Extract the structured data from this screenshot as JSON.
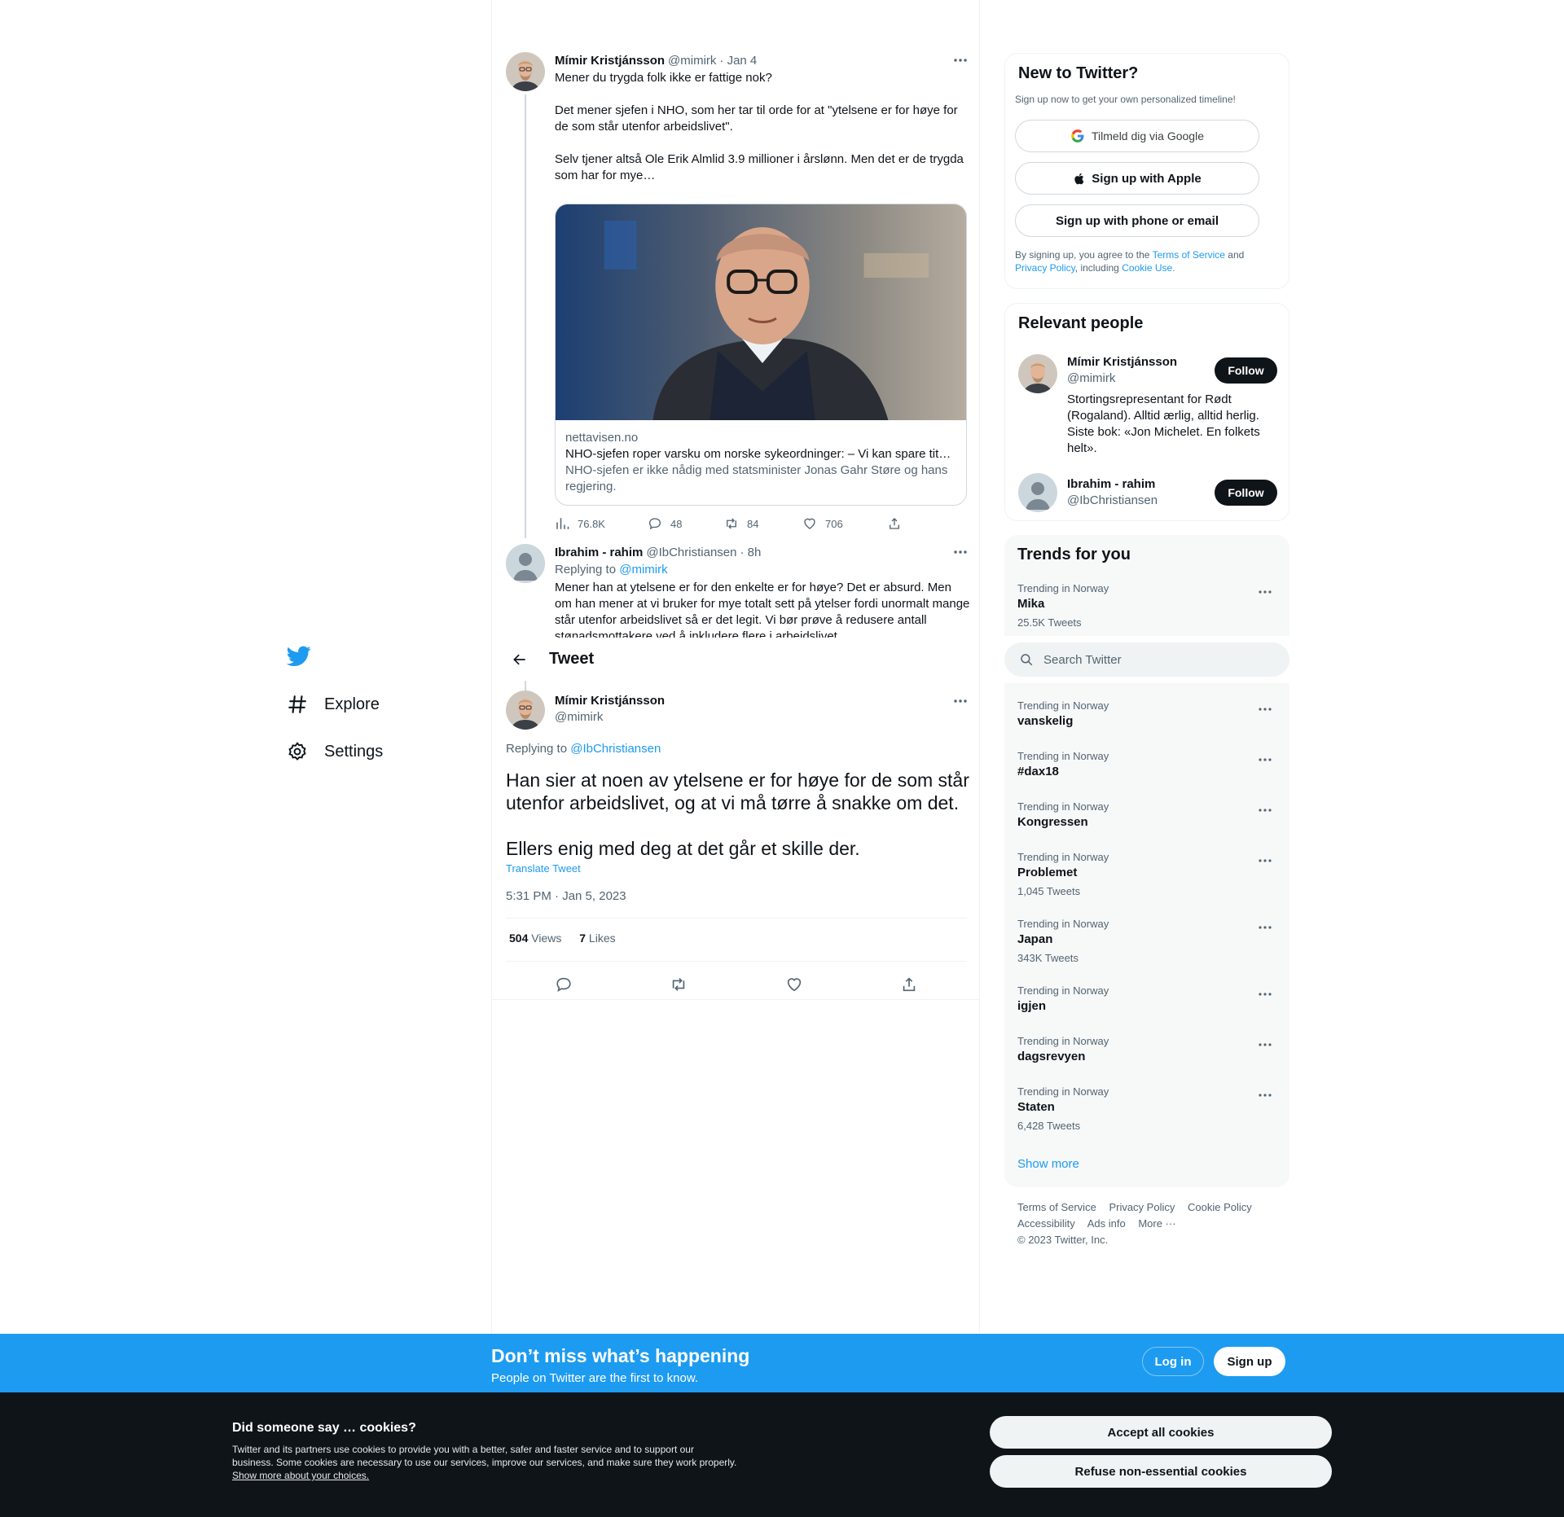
{
  "nav": {
    "items": [
      {
        "label": "Explore",
        "icon": "hashtag-icon"
      },
      {
        "label": "Settings",
        "icon": "gear-icon"
      }
    ]
  },
  "thread": {
    "tweet1": {
      "name": "Mímir Kristjánsson",
      "handle": "@mimirk",
      "time": "· Jan 4",
      "text": "Mener du trygda folk ikke er fattige nok?\n\nDet mener sjefen i NHO, som her tar til orde for at \"ytelsene er for høye for de som står utenfor arbeidslivet\".\n\nSelv tjener altså Ole Erik Almlid 3.9 millioner i årslønn. Men det er de trygda som har for mye…",
      "card": {
        "domain": "nettavisen.no",
        "title": "NHO-sjefen roper varsku om norske sykeordninger: – Vi kan spare tital…",
        "description": "NHO-sjefen er ikke nådig med statsminister Jonas Gahr Støre og hans regjering."
      },
      "stats": {
        "views": "76.8K",
        "replies": "48",
        "retweets": "84",
        "likes": "706"
      }
    },
    "tweet2": {
      "name": "Ibrahim - rahim",
      "handle": "@IbChristiansen",
      "time": "· 8h",
      "replying_label": "Replying to",
      "replying_to": "@mimirk",
      "text": "Mener han at ytelsene er for den enkelte er for høye? Det er absurd. Men om han mener at vi bruker for mye totalt sett på ytelser fordi unormalt mange står utenfor arbeidslivet så er det legit. Vi bør prøve å redusere antall stønadsmottakere ved å inkludere flere i arbeidslivet"
    }
  },
  "header": {
    "title": "Tweet"
  },
  "main_tweet": {
    "name": "Mímir Kristjánsson",
    "handle": "@mimirk",
    "replying_label": "Replying to",
    "replying_to": "@IbChristiansen",
    "text": "Han sier at noen av ytelsene er for høye for de som står utenfor arbeidslivet, og at vi må tørre å snakke om det.\n\nEllers enig med deg at det går et skille der.",
    "translate": "Translate Tweet",
    "timestamp": "5:31 PM · Jan 5, 2023",
    "views_count": "504",
    "views_label": "Views",
    "likes_count": "7",
    "likes_label": "Likes"
  },
  "new_to_twitter": {
    "title": "New to Twitter?",
    "subtitle": "Sign up now to get your own personalized timeline!",
    "google": "Tilmeld dig via Google",
    "apple": "Sign up with Apple",
    "phone": "Sign up with phone or email",
    "legal_1": "By signing up, you agree to the",
    "terms": "Terms of Service",
    "legal_2": "and",
    "privacy": "Privacy Policy",
    "legal_3": ", including",
    "cookie": "Cookie Use."
  },
  "relevant_people": {
    "title": "Relevant people",
    "people": [
      {
        "name": "Mímir Kristjánsson",
        "handle": "@mimirk",
        "bio": "Stortingsrepresentant for Rødt (Rogaland). Alltid ærlig, alltid herlig. Siste bok: «Jon Michelet. En folkets helt».",
        "follow": "Follow"
      },
      {
        "name": "Ibrahim - rahim",
        "handle": "@IbChristiansen",
        "follow": "Follow"
      }
    ]
  },
  "trends": {
    "title": "Trends for you",
    "items": [
      {
        "context": "Trending in Norway",
        "name": "Mika",
        "count": "25.5K Tweets"
      },
      {
        "context": "Trending in Norway",
        "name": "vanskelig",
        "count": ""
      },
      {
        "context": "Trending in Norway",
        "name": "#dax18",
        "count": ""
      },
      {
        "context": "Trending in Norway",
        "name": "Kongressen",
        "count": ""
      },
      {
        "context": "Trending in Norway",
        "name": "Problemet",
        "count": "1,045 Tweets"
      },
      {
        "context": "Trending in Norway",
        "name": "Japan",
        "count": "343K Tweets"
      },
      {
        "context": "Trending in Norway",
        "name": "igjen",
        "count": ""
      },
      {
        "context": "Trending in Norway",
        "name": "dagsrevyen",
        "count": ""
      },
      {
        "context": "Trending in Norway",
        "name": "Staten",
        "count": "6,428 Tweets"
      }
    ],
    "show_more": "Show more"
  },
  "search": {
    "placeholder": "Search Twitter"
  },
  "footer": {
    "terms": "Terms of Service",
    "privacy": "Privacy Policy",
    "cookie": "Cookie Policy",
    "accessibility": "Accessibility",
    "ads": "Ads info",
    "more": "More ···",
    "copyright": "© 2023 Twitter, Inc."
  },
  "signup_bar": {
    "heading": "Don’t miss what’s happening",
    "sub": "People on Twitter are the first to know.",
    "login": "Log in",
    "signup": "Sign up"
  },
  "cookies": {
    "heading": "Did someone say … cookies?",
    "body": "Twitter and its partners use cookies to provide you with a better, safer and faster service and to support our business. Some cookies are necessary to use our services, improve our services, and make sure they work properly.",
    "link": "Show more about your choices.",
    "accept": "Accept all cookies",
    "refuse": "Refuse non-essential cookies"
  },
  "colors": {
    "accent": "#1d9bf0",
    "text": "#0f1419",
    "muted": "#536471",
    "border": "#eff3f4",
    "dark": "#0f1419"
  }
}
